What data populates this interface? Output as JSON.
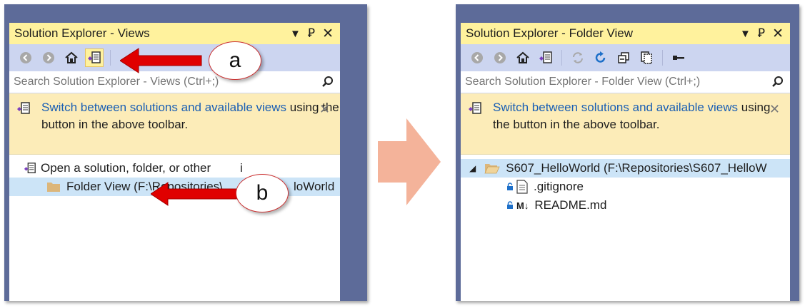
{
  "left_panel": {
    "title": "Solution Explorer - Views",
    "search_placeholder": "Search Solution Explorer - Views (Ctrl+;)",
    "info": {
      "link_text": "Switch between solutions and available views",
      "rest_text": " using the button in the above toolbar."
    },
    "tree": {
      "row1": "Open a solution, folder, or other",
      "row1_tail": "i",
      "row2": "Folder View (F:\\Repositories\\",
      "row2_tail": "loWorld"
    }
  },
  "right_panel": {
    "title": "Solution Explorer - Folder View",
    "search_placeholder": "Search Solution Explorer - Folder View (Ctrl+;)",
    "info": {
      "link_text": "Switch between solutions and available views",
      "rest_text": " using the button in the above toolbar."
    },
    "tree": {
      "root": "S607_HelloWorld (F:\\Repositories\\S607_HelloW",
      "files": [
        ".gitignore",
        "README.md"
      ]
    }
  },
  "callouts": {
    "a": "a",
    "b": "b"
  },
  "colors": {
    "frame": "#5d6b99",
    "title_active": "#fff29d",
    "toolbar": "#ccd5f0",
    "infobar": "#fcecb8",
    "link": "#1a5fb4",
    "selection": "#cce4f7",
    "red_arrow": "#e00000",
    "transition_arrow": "#f4b39a"
  },
  "icons": [
    "back-icon",
    "forward-icon",
    "home-icon",
    "switch-views-icon",
    "sync-icon",
    "refresh-icon",
    "collapse-all-icon",
    "show-all-files-icon",
    "properties-icon",
    "search-icon",
    "folder-icon",
    "file-icon",
    "lock-icon",
    "markdown-icon"
  ]
}
